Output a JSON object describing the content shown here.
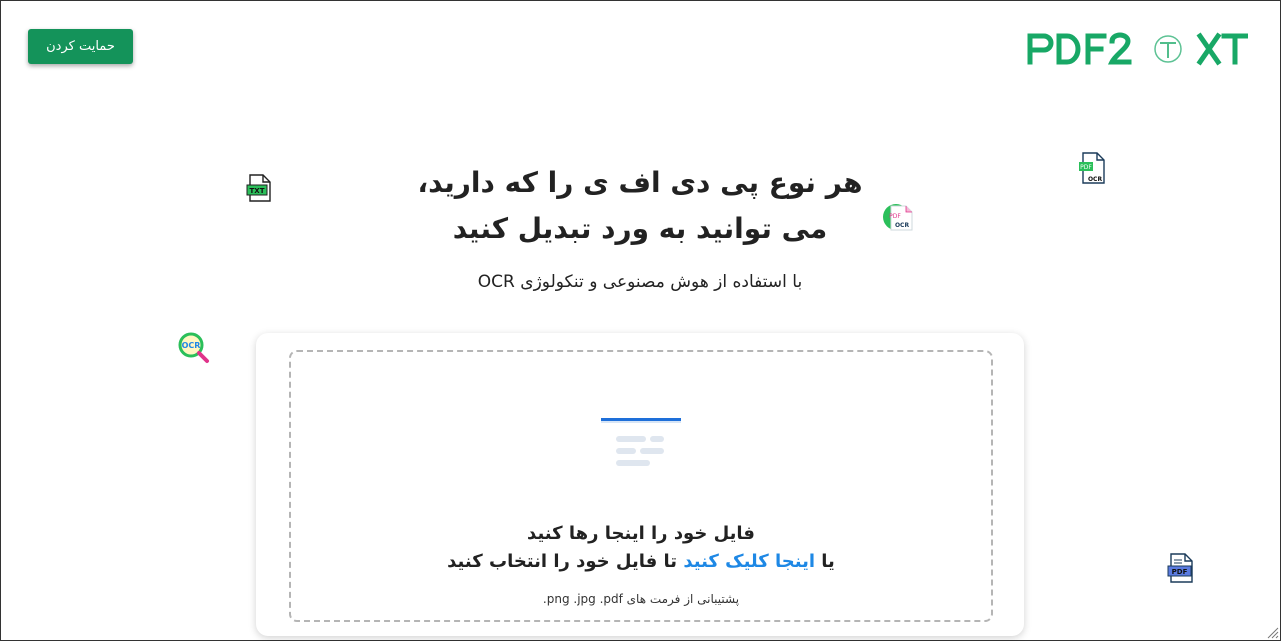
{
  "header": {
    "support_label": "حمایت کردن",
    "logo_text": "PDF2TXT"
  },
  "hero": {
    "title_line1": "هر نوع پی دی اف ی را که دارید،",
    "title_line2": "می توانید به ورد تبدیل کنید",
    "subtitle": "با استفاده از هوش مصنوعی و تنکولوژی OCR"
  },
  "upload": {
    "drop_text": "فایل خود را اینجا رها کنید",
    "or_prefix": "یا ",
    "click_link": "اینجا کلیک کنید",
    "click_suffix": " تا فایل خود را انتخاب کنید",
    "formats": "پشتیبانی از فرمت های png .jpg .pdf."
  },
  "decorations": {
    "txt_icon_label": "TXT",
    "ocr_search_label": "OCR",
    "pdf_ocr_top_label": "OCR",
    "pdf_ocr_top_badge": "PDF",
    "pdf_ocr_mid_label": "OCR",
    "pdf_ocr_mid_badge": "PDF",
    "pdf_bottom_label": "PDF"
  },
  "colors": {
    "brand_green": "#14935a",
    "link_blue": "#1e88e5",
    "logo_green": "#18a866"
  }
}
